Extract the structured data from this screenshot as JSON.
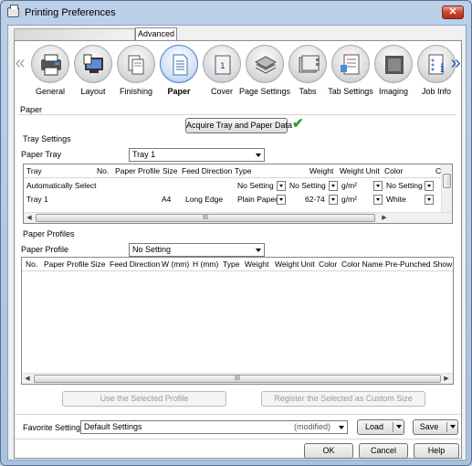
{
  "window": {
    "title": "Printing Preferences",
    "close_glyph": "✕"
  },
  "tabs": {
    "advanced": "Advanced"
  },
  "ribbon": {
    "items": [
      {
        "label": "General"
      },
      {
        "label": "Layout"
      },
      {
        "label": "Finishing"
      },
      {
        "label": "Paper"
      },
      {
        "label": "Cover"
      },
      {
        "label": "Page Settings"
      },
      {
        "label": "Tabs"
      },
      {
        "label": "Tab Settings"
      },
      {
        "label": "Imaging"
      },
      {
        "label": "Job Info"
      }
    ],
    "active": "Paper",
    "prev_glyph": "«",
    "next_glyph": "»"
  },
  "paper": {
    "section_title": "Paper",
    "acquire_button": "Acquire Tray and Paper Data",
    "tray_settings_title": "Tray Settings",
    "paper_tray_label": "Paper Tray",
    "paper_tray_value": "Tray 1",
    "tray_table": {
      "columns": [
        "Tray",
        "No.",
        "Paper Profile",
        "Size",
        "Feed Direction",
        "Type",
        "Weight",
        "Weight Unit",
        "Color",
        "C"
      ],
      "rows": [
        {
          "tray": "Automatically Select",
          "no": "",
          "profile": "",
          "size": "",
          "feed": "",
          "type": "No Setting",
          "weight": "No Setting",
          "unit": "g/m²",
          "color": "No Setting"
        },
        {
          "tray": "Tray 1",
          "no": "",
          "profile": "",
          "size": "A4",
          "feed": "Long Edge",
          "type": "Plain Paper",
          "weight": "62-74",
          "unit": "g/m²",
          "color": "White"
        }
      ],
      "scroll_grip": "III"
    },
    "profiles_title": "Paper Profiles",
    "paper_profile_label": "Paper Profile",
    "paper_profile_value": "No Setting",
    "profile_table": {
      "columns": [
        "No.",
        "Paper Profile",
        "Size",
        "Feed Direction",
        "W (mm)",
        "H (mm)",
        "Type",
        "Weight",
        "Weight Unit",
        "Color",
        "Color Name",
        "Pre-Punched",
        "Show"
      ],
      "scroll_grip": "III"
    },
    "use_selected_button": "Use the Selected Profile",
    "register_button": "Register the Selected as Custom Size"
  },
  "favorites": {
    "label": "Favorite Setting",
    "value": "Default Settings",
    "modified": "(modified)",
    "load_button": "Load",
    "save_button": "Save"
  },
  "dialog_buttons": {
    "ok": "OK",
    "cancel": "Cancel",
    "help": "Help"
  },
  "colors": {
    "accent": "#4a7fc3",
    "check": "#2fa02f",
    "close": "#c8452f"
  }
}
